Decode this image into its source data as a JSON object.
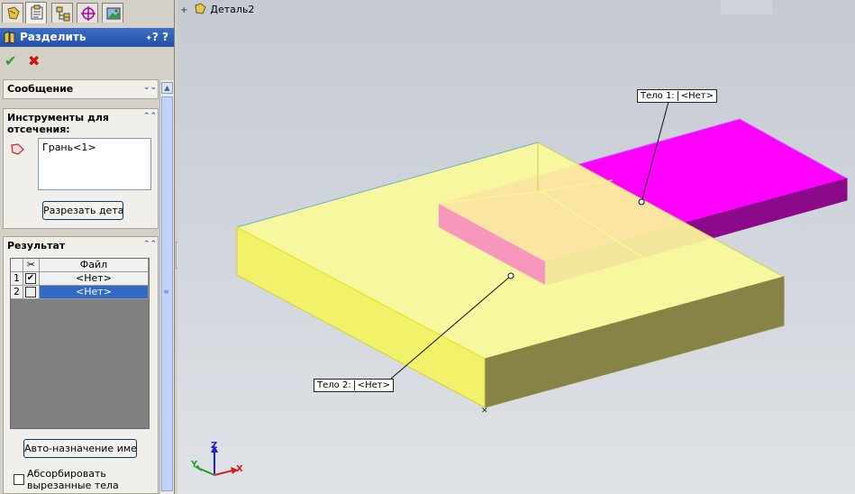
{
  "tabs": [
    "feature-manager-tab",
    "property-manager-tab",
    "configuration-manager-tab",
    "dimxpert-tab",
    "display-manager-tab"
  ],
  "panel": {
    "title": "Разделить",
    "help_label": "?",
    "ok_icon": "check-icon",
    "cancel_icon": "x-icon"
  },
  "message_group": {
    "title": "Сообщение"
  },
  "tools_group": {
    "title_line1": "Инструменты для",
    "title_line2": "отсечения:",
    "list_items": [
      "Грань<1>"
    ],
    "cut_button": "Разрезать деталь"
  },
  "result_group": {
    "title": "Результат",
    "columns": [
      "",
      "Файл"
    ],
    "rows": [
      {
        "num": "1",
        "checked": true,
        "file": "<Нет>"
      },
      {
        "num": "2",
        "checked": false,
        "file": "<Нет>"
      }
    ],
    "auto_name_button": "Авто-назначение имен",
    "absorb_label_line1": "Абсорбировать",
    "absorb_label_line2": "вырезанные тела"
  },
  "tree": {
    "expander": "+",
    "part_name": "Деталь2"
  },
  "callouts": {
    "body1": {
      "label": "Тело 1:",
      "value": "<Нет>"
    },
    "body2": {
      "label": "Тело 2:",
      "value": "<Нет>"
    }
  },
  "triad": {
    "x": "X",
    "y": "Y",
    "z": "Z"
  },
  "colors": {
    "body1": "#ff00ff",
    "body2": "#ffff7a",
    "selection_blue": "#316ac5"
  }
}
